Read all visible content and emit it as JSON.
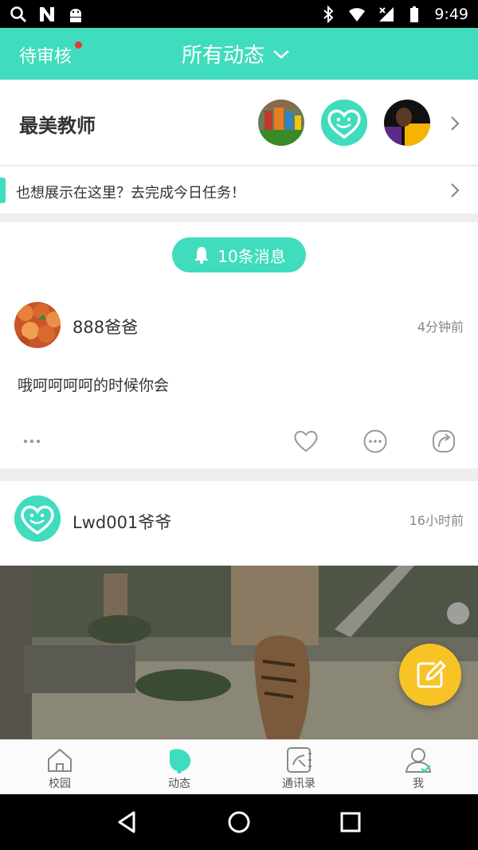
{
  "status_bar": {
    "time": "9:49"
  },
  "header": {
    "pending_label": "待审核",
    "title": "所有动态"
  },
  "teachers": {
    "title": "最美教师"
  },
  "task_banner": {
    "text": "也想展示在这里？去完成今日任务！"
  },
  "feed": {
    "messages_label": "10条消息",
    "post1": {
      "username": "888爸爸",
      "time": "4分钟前",
      "text": "哦呵呵呵呵的时候你会"
    },
    "post2": {
      "username": "Lwd001爷爷",
      "time": "16小时前"
    }
  },
  "tabs": [
    {
      "label": "校园",
      "icon": "house-icon"
    },
    {
      "label": "动态",
      "icon": "bell-icon"
    },
    {
      "label": "通讯录",
      "icon": "contacts-icon"
    },
    {
      "label": "我",
      "icon": "user-icon"
    }
  ],
  "colors": {
    "accent": "#3fdcbd",
    "fab": "#f7c325",
    "badge": "#e53935"
  }
}
